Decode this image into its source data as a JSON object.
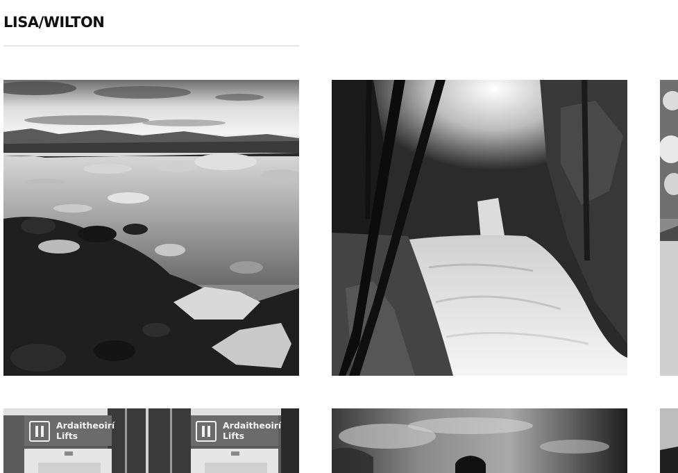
{
  "site": {
    "logo": "LISA/WILTON"
  },
  "gallery": {
    "tiles": [
      {
        "subject": "glacier lagoon with ice on black pebble shore"
      },
      {
        "subject": "waterfall in forest"
      },
      {
        "subject": "cloudy sky and dunes (cropped)"
      },
      {
        "subject": "airport lift signs",
        "signs": [
          {
            "line1": "Ardaitheoirí",
            "line2": "Lifts"
          },
          {
            "line1": "Ardaitheoirí",
            "line2": "Lifts"
          }
        ]
      },
      {
        "subject": "dramatic sky with silhouette"
      },
      {
        "subject": "dark landscape (cropped)"
      }
    ]
  },
  "colors": {
    "background": "#ffffff",
    "logo": "#111111",
    "rule": "#e6e6e6"
  }
}
